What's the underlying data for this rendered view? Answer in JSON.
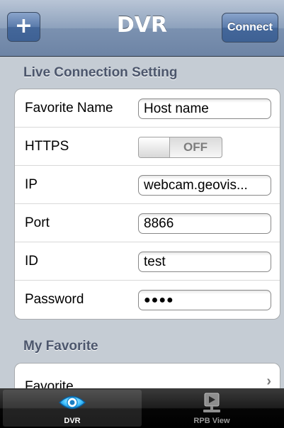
{
  "navbar": {
    "title": "DVR",
    "add_label": "+",
    "connect_label": "Connect"
  },
  "live_section": {
    "header": "Live Connection Setting",
    "rows": [
      {
        "label": "Favorite Name",
        "value": "Host name"
      },
      {
        "label": "HTTPS",
        "toggle_text": "OFF",
        "toggle_on": false
      },
      {
        "label": "IP",
        "value": "webcam.geovis..."
      },
      {
        "label": "Port",
        "value": "8866"
      },
      {
        "label": "ID",
        "value": "test"
      },
      {
        "label": "Password",
        "value": "●●●●"
      }
    ]
  },
  "favorite_section": {
    "header": "My Favorite",
    "rows": [
      {
        "label": "Favorite"
      }
    ]
  },
  "tabbar": {
    "tabs": [
      {
        "label": "DVR",
        "icon": "eye-icon",
        "active": true
      },
      {
        "label": "RPB View",
        "icon": "playback-icon",
        "active": false
      }
    ]
  },
  "colors": {
    "navbar": "#7b91b0",
    "background": "#c5ccd4",
    "section_header": "#4c566c",
    "tabbar": "#000000"
  }
}
